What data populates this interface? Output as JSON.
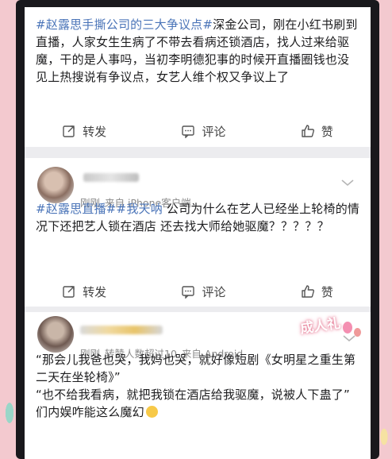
{
  "posts": [
    {
      "text_segments": [
        {
          "text": "#赵露思手撕公司的三大争议点#",
          "type": "tag"
        },
        {
          "text": "深金公司，刚在小红书刷到直播，人家女生生病了不带去看病还锁酒店，找人过来给驱魔，干的是人事吗，当初李明德犯事的时候开直播圈钱也没见上热搜说有争议点，女艺人维个权又争议上了",
          "type": "text"
        }
      ],
      "actions": {
        "repost": "转发",
        "comment": "评论",
        "like": "赞"
      }
    },
    {
      "meta": {
        "time": "刚刚",
        "source": "来自 iPhone客户端"
      },
      "text_segments": [
        {
          "text": "#赵露思直播#",
          "type": "tag"
        },
        {
          "text": "#我天呐",
          "type": "tag"
        },
        {
          "text": " 公司为什么在艺人已经坐上轮椅的情况下还把艺人锁在酒店 还去找大师给她驱魔？？？？？",
          "type": "text"
        }
      ],
      "actions": {
        "repost": "转发",
        "comment": "评论",
        "like": "赞"
      }
    },
    {
      "meta": {
        "time": "刚刚",
        "reposts": "转赞人数超过10",
        "source": "来自 Android"
      },
      "badge": "成人礼",
      "lines": [
        "“那会儿我爸也哭，我妈也哭，就好像短剧《女明星之重生第二天在坐轮椅》”",
        "“也不给我看病，就把我锁在酒店给我驱魔，说被人下蛊了”",
        "们内娱咋能这么魔幻"
      ],
      "emoji": "face-with-sweat-icon"
    }
  ],
  "colors": {
    "tag": "#4a74b8",
    "text": "#1d1d1f",
    "meta": "#8a8a8a"
  }
}
